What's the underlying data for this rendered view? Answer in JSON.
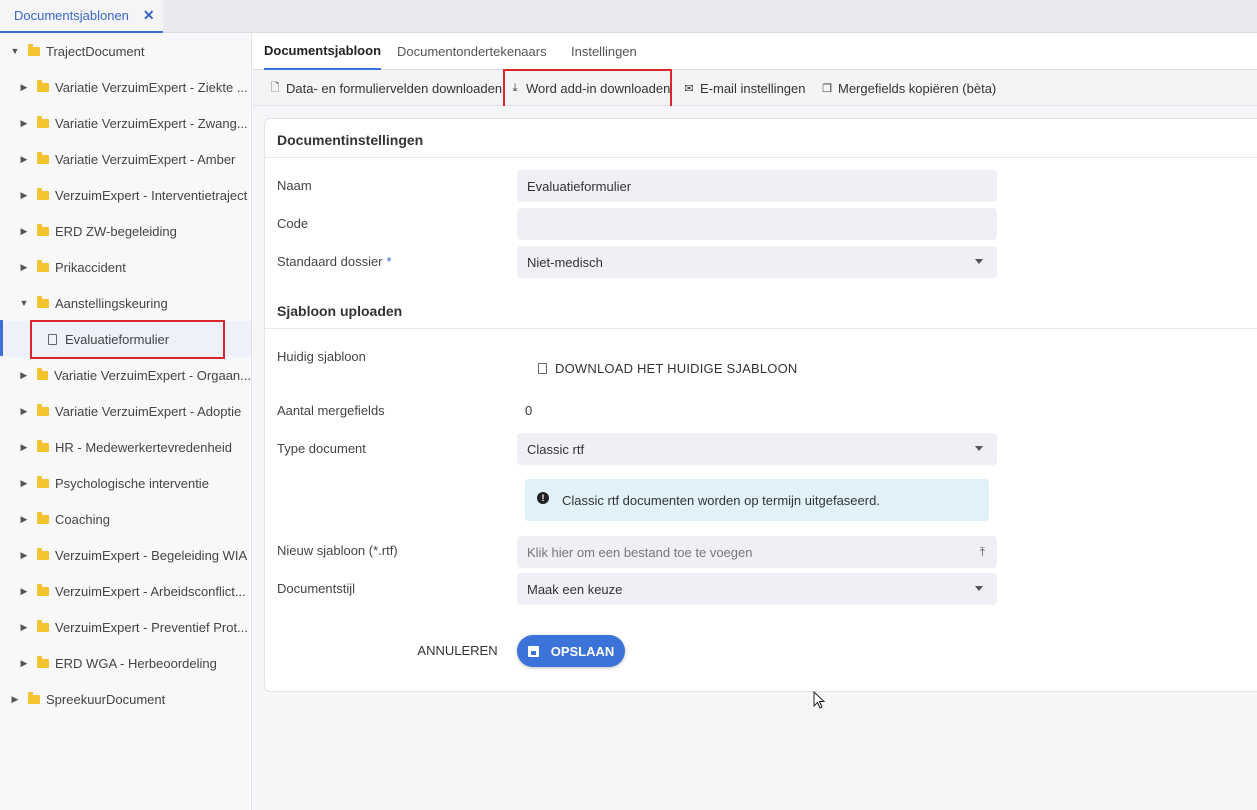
{
  "top_tab": {
    "label": "Documentsjablonen",
    "close": "✕"
  },
  "tree": {
    "root": "TrajectDocument",
    "items": [
      "Variatie VerzuimExpert - Ziekte ...",
      "Variatie VerzuimExpert - Zwang...",
      "Variatie VerzuimExpert - Amber",
      "VerzuimExpert - Interventietraject",
      "ERD ZW-begeleiding",
      "Prikaccident",
      "Aanstellingskeuring",
      "Evaluatieformulier",
      "Variatie VerzuimExpert - Orgaan...",
      "Variatie VerzuimExpert - Adoptie",
      "HR - Medewerkertevredenheid",
      "Psychologische interventie",
      "Coaching",
      "VerzuimExpert - Begeleiding WIA",
      "VerzuimExpert - Arbeidsconflict...",
      "VerzuimExpert - Preventief Prot...",
      "ERD WGA - Herbeoordeling"
    ],
    "root2": "SpreekuurDocument"
  },
  "subtabs": [
    "Documentsjabloon",
    "Documentondertekenaars",
    "Instellingen"
  ],
  "toolbar": {
    "data_download": "Data- en formuliervelden downloaden",
    "word_addin": "Word add-in downloaden",
    "email_settings": "E-mail instellingen",
    "mergefields_copy": "Mergefields kopiëren (bèta)"
  },
  "doc_settings": {
    "title": "Documentinstellingen",
    "naam_label": "Naam",
    "naam_value": "Evaluatieformulier",
    "code_label": "Code",
    "code_value": "",
    "dossier_label": "Standaard dossier",
    "required_mark": "*",
    "dossier_value": "Niet-medisch"
  },
  "upload": {
    "title": "Sjabloon uploaden",
    "current_label": "Huidig sjabloon",
    "current_link": "DOWNLOAD HET HUIDIGE SJABLOON",
    "mergefields_label": "Aantal mergefields",
    "mergefields_value": "0",
    "type_label": "Type document",
    "type_value": "Classic rtf",
    "info_text": "Classic rtf documenten worden op termijn uitgefaseerd.",
    "new_label": "Nieuw sjabloon (*.rtf)",
    "new_placeholder": "Klik hier om een bestand toe te voegen",
    "style_label": "Documentstijl",
    "style_value": "Maak een keuze"
  },
  "actions": {
    "cancel": "ANNULEREN",
    "save": "OPSLAAN"
  },
  "colors": {
    "accent": "#3b73d9",
    "highlight": "#d9262c",
    "folder": "#f4c430",
    "info_bg": "#e0f1fa"
  }
}
